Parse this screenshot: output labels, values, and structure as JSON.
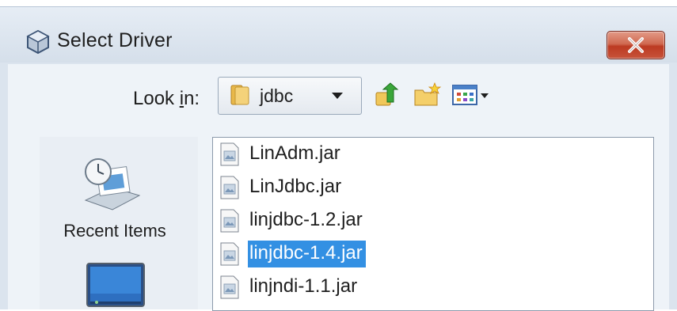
{
  "window": {
    "title": "Select Driver",
    "close_icon": "close-icon",
    "title_icon": "dialog-cube-icon"
  },
  "toolbar": {
    "lookin_prefix": "Look ",
    "lookin_mnemonic": "i",
    "lookin_suffix": "n:",
    "folder_name": "jdbc",
    "buttons": [
      "up-one-level-icon",
      "create-new-folder-icon",
      "view-menu-icon"
    ]
  },
  "places": {
    "items": [
      {
        "label": "Recent Items",
        "icon": "recent-items-icon"
      },
      {
        "label": "",
        "icon": "desktop-icon"
      }
    ]
  },
  "files": {
    "items": [
      {
        "name": "LinAdm.jar",
        "selected": false
      },
      {
        "name": "LinJdbc.jar",
        "selected": false
      },
      {
        "name": "linjdbc-1.2.jar",
        "selected": false
      },
      {
        "name": "linjdbc-1.4.jar",
        "selected": true
      },
      {
        "name": "linjndi-1.1.jar",
        "selected": false
      }
    ]
  },
  "colors": {
    "selection": "#3390e3",
    "close_button": "#c7533a",
    "background": "#eef3f8"
  }
}
